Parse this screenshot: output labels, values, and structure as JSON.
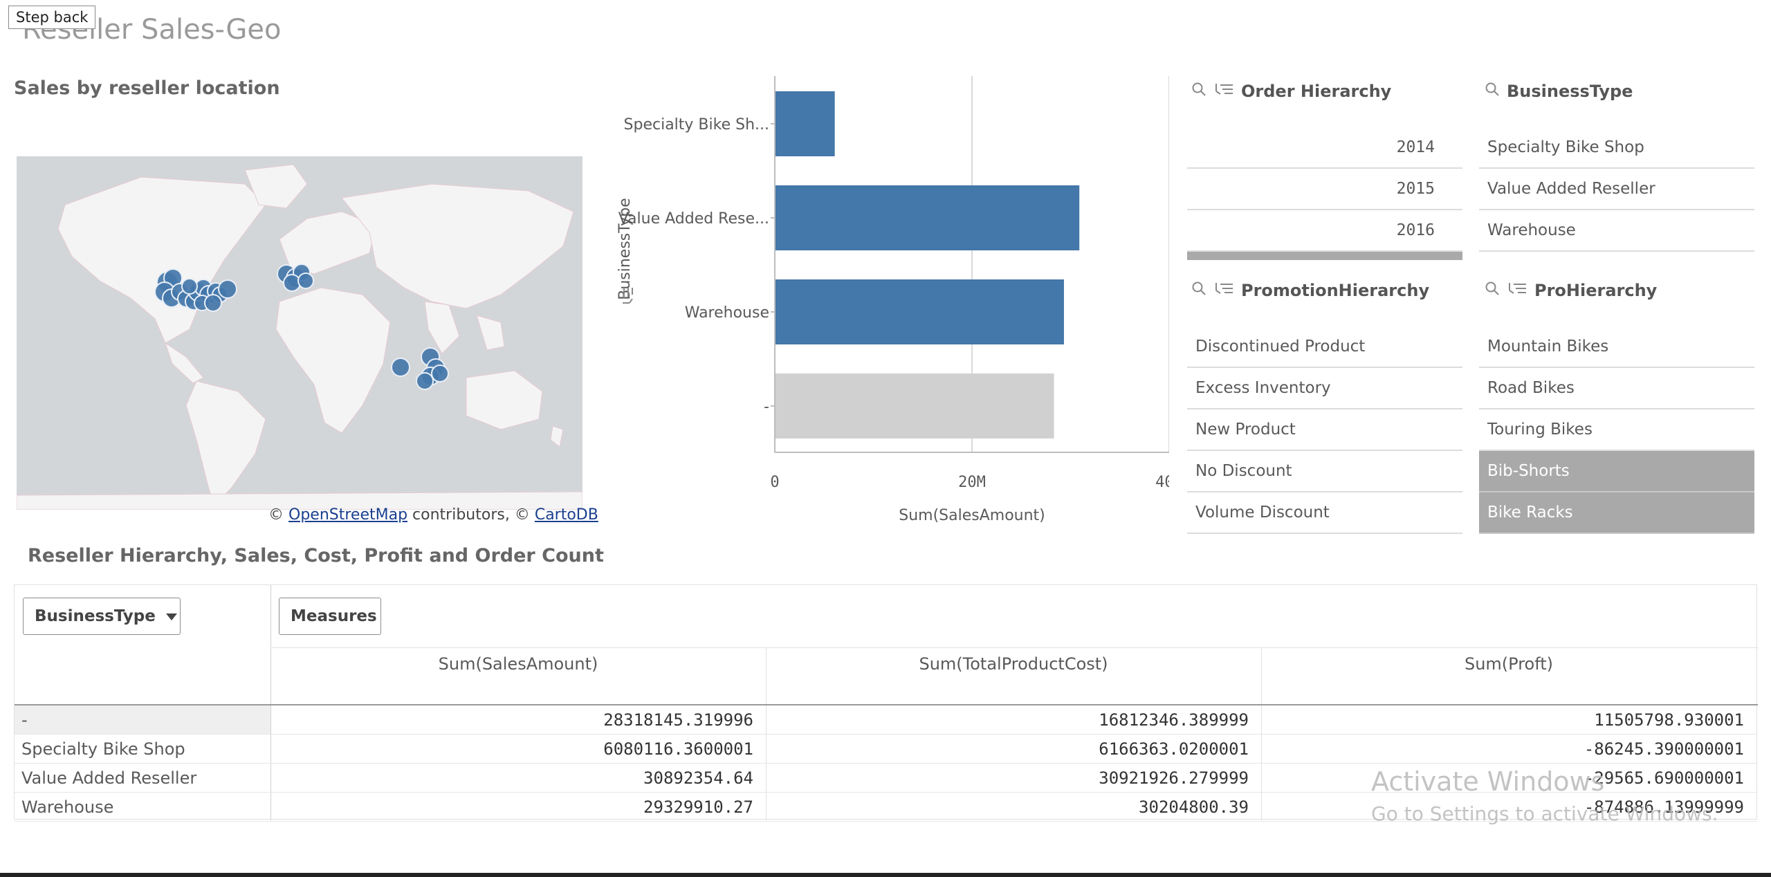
{
  "app": {
    "step_back_label": "Step back",
    "sheet_title": "Reseller Sales-Geo"
  },
  "map": {
    "title": "Sales by reseller location",
    "attribution_prefix": "©",
    "attribution_link1": "OpenStreetMap",
    "attribution_middle": "contributors, ©",
    "attribution_link2": "CartoDB",
    "land_color": "#f4f4f4",
    "water_color": "#d3d6d8",
    "point_color": "#4477aa"
  },
  "chart_data": {
    "type": "bar",
    "orientation": "horizontal",
    "categories": [
      "Specialty Bike Sh...",
      "Value Added Rese...",
      "Warehouse",
      "-"
    ],
    "values": [
      6080116.36,
      30892354.64,
      29329910.27,
      28318145.32
    ],
    "colors": [
      "#4477aa",
      "#4477aa",
      "#4477aa",
      "#d0d0d0"
    ],
    "xlabel": "Sum(SalesAmount)",
    "ylabel": "BusinessType",
    "x_ticks": [
      "0",
      "20M",
      "40M"
    ],
    "xlim": [
      0,
      40000000
    ],
    "grid": true
  },
  "filters": {
    "order_hierarchy": {
      "title": "Order Hierarchy",
      "items": [
        "2014",
        "2015",
        "2016"
      ]
    },
    "business_type": {
      "title": "BusinessType",
      "items": [
        "Specialty Bike Shop",
        "Value Added Reseller",
        "Warehouse"
      ]
    },
    "promotion_hierarchy": {
      "title": "PromotionHierarchy",
      "items": [
        "Discontinued Product",
        "Excess Inventory",
        "New Product",
        "No Discount",
        "Volume Discount"
      ]
    },
    "pro_hierarchy": {
      "title": "ProHierarchy",
      "items": [
        "Mountain Bikes",
        "Road Bikes",
        "Touring Bikes",
        "Bib-Shorts",
        "Bike Racks"
      ]
    }
  },
  "pivot": {
    "title": "Reseller Hierarchy, Sales, Cost, Profit and Order Count",
    "dimension_button": "BusinessType",
    "measures_button": "Measures",
    "columns": [
      "Sum(SalesAmount)",
      "Sum(TotalProductCost)",
      "Sum(Proft)"
    ],
    "rows": [
      {
        "label": "-",
        "values": [
          "28318145.319996",
          "16812346.389999",
          "11505798.930001"
        ]
      },
      {
        "label": "Specialty Bike Shop",
        "values": [
          "6080116.3600001",
          "6166363.0200001",
          "-86245.390000001"
        ]
      },
      {
        "label": "Value Added Reseller",
        "values": [
          "30892354.64",
          "30921926.279999",
          "-29565.690000001"
        ]
      },
      {
        "label": "Warehouse",
        "values": [
          "29329910.27",
          "30204800.39",
          "-874886.13999999"
        ]
      }
    ]
  },
  "watermark": {
    "line1": "Activate Windows",
    "line2": "Go to Settings to activate Windows."
  }
}
